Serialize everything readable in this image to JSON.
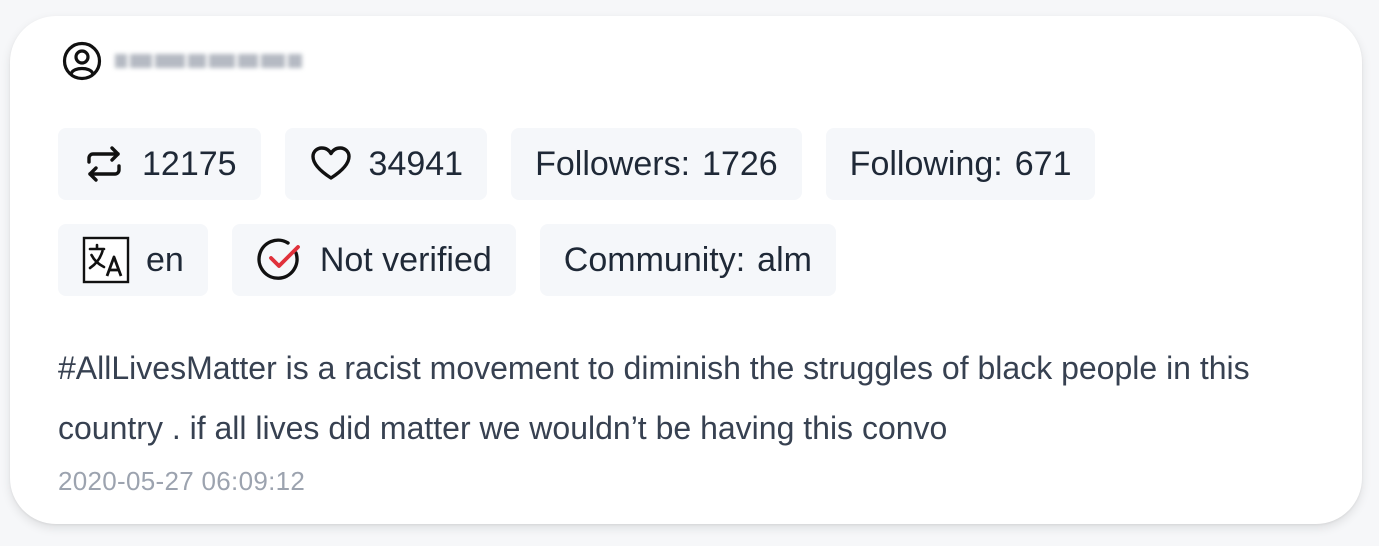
{
  "user": {
    "icon": "user-circle-icon",
    "name_redacted": true
  },
  "stats": {
    "retweets": {
      "icon": "retweet-icon",
      "value": "12175"
    },
    "likes": {
      "icon": "heart-icon",
      "value": "34941"
    },
    "followers": {
      "label": "Followers:",
      "value": "1726"
    },
    "following": {
      "label": "Following:",
      "value": "671"
    }
  },
  "meta": {
    "language": {
      "icon": "translate-icon",
      "value": "en"
    },
    "verification": {
      "icon": "check-circle-icon",
      "value": "Not verified",
      "accent": "#e0313b"
    },
    "community": {
      "label": "Community:",
      "value": "alm"
    }
  },
  "tweet": {
    "text": "#AllLivesMatter is a racist movement to diminish the struggles of black people in this country . if all lives did matter we wouldn’t be having this convo",
    "timestamp": "2020-05-27 06:09:12"
  }
}
